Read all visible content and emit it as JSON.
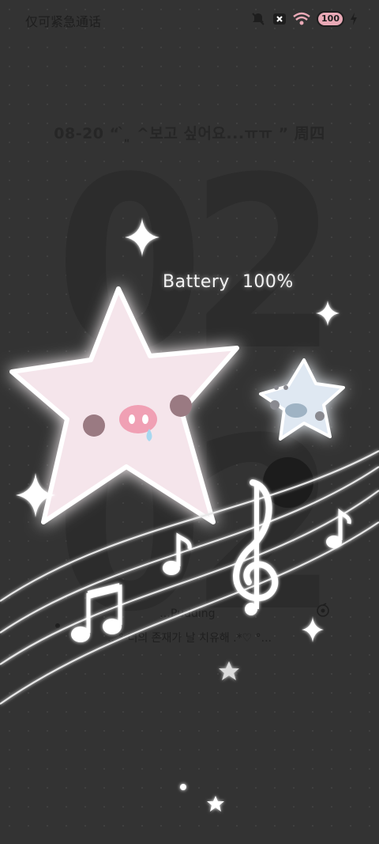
{
  "status_bar": {
    "carrier_text": "仅可紧急通话",
    "icons": [
      "mute-icon",
      "no-sim-icon",
      "wifi-icon",
      "battery-icon",
      "charging-icon"
    ],
    "battery_level": "100"
  },
  "lockscreen": {
    "date_text": "08-20 “ ̀ ͈ ^보고 싶어요...ㅠㅠ ”  周四",
    "clock_text": "02 02",
    "battery_label": "Battery",
    "battery_percent": "100%"
  },
  "music": {
    "title": "…Pudding",
    "lyric": "…° 너의 존재가 날 치유해 .*♡ °...",
    "icon": "music-app-icon"
  },
  "colors": {
    "background": "#333333",
    "pink_star": "#f7e6ec",
    "blue_star": "#dfe8f2",
    "battery_badge": "#e9a9b6"
  }
}
